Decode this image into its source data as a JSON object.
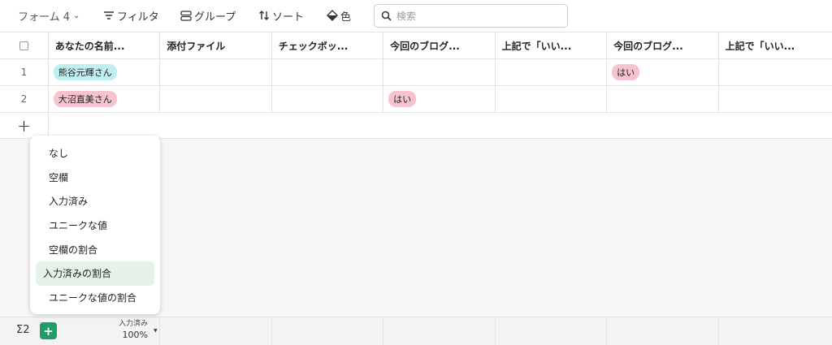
{
  "toolbar": {
    "view_label": "フォーム 4",
    "filter_label": "フィルタ",
    "group_label": "グループ",
    "sort_label": "ソート",
    "color_label": "色",
    "search_placeholder": "検索"
  },
  "table": {
    "columns": [
      "あなたの名前...",
      "添付ファイル",
      "チェックボッ...",
      "今回のブログ...",
      "上記で「いい...",
      "今回のブログ...",
      "上記で「いい..."
    ],
    "rows": [
      {
        "num": "1",
        "name": "熊谷元輝さん",
        "col4": "",
        "col6": "はい"
      },
      {
        "num": "2",
        "name": "大沼直美さん",
        "col4": "はい",
        "col6": ""
      }
    ]
  },
  "footer": {
    "sigma_label": "Σ2",
    "summary_label": "入力済み",
    "summary_value": "100%"
  },
  "menu": {
    "items": [
      "なし",
      "空欄",
      "入力済み",
      "ユニークな値",
      "空欄の割合",
      "入力済みの割合",
      "ユニークな値の割合"
    ],
    "selected": "入力済みの割合"
  },
  "colors": {
    "tag_cyan": "#bfeff0",
    "tag_pink": "#f7c3cf",
    "accent_green": "#1e9e63",
    "selected_bg": "#e4f2ea"
  }
}
